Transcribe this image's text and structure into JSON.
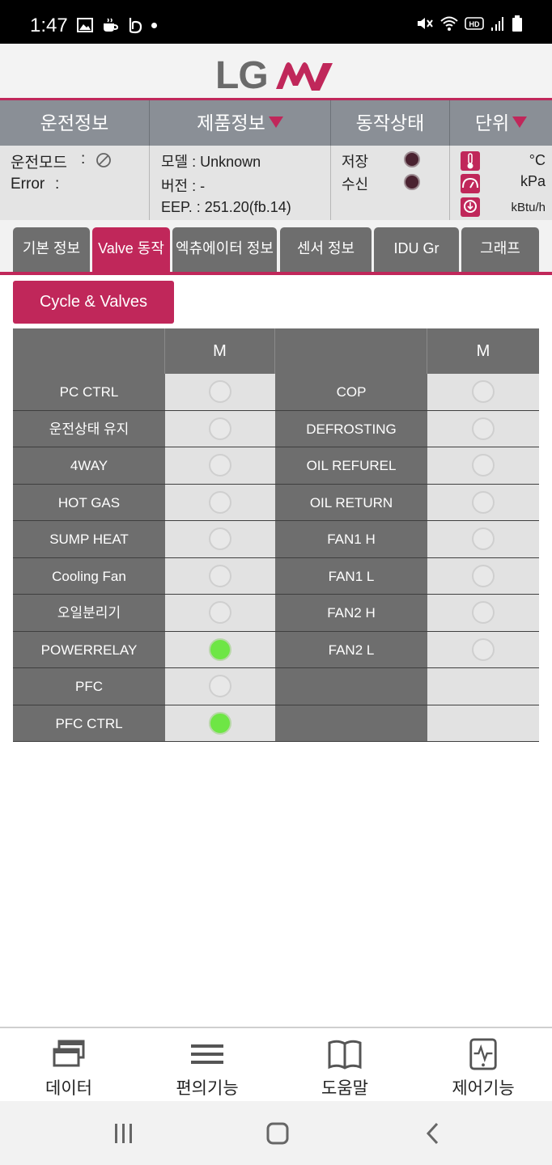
{
  "status_bar": {
    "time": "1:47"
  },
  "header": {
    "logo_lg": "LG",
    "logo_mv": "MV",
    "brand_color": "#c0275a"
  },
  "info_panel": {
    "headers": [
      "운전정보",
      "제품정보",
      "동작상태",
      "단위"
    ],
    "operation": {
      "mode_label": "운전모드",
      "mode_sep": ":",
      "error_label": "Error",
      "error_sep": ":"
    },
    "product": {
      "model": "모델 : Unknown",
      "version": "버전 : -",
      "eep": "EEP. : 251.20(fb.14)"
    },
    "status": {
      "save_label": "저장",
      "receive_label": "수신"
    },
    "units": {
      "temperature": "°C",
      "pressure": "kPa",
      "capacity": "kBtu/h"
    }
  },
  "tabs": [
    {
      "label": "기본 정보",
      "active": false
    },
    {
      "label": "Valve 동작",
      "active": true
    },
    {
      "label": "엑츄에이터 정보",
      "active": false
    },
    {
      "label": "센서 정보",
      "active": false
    },
    {
      "label": "IDU Gr",
      "active": false
    },
    {
      "label": "그래프",
      "active": false
    }
  ],
  "cycle_button": "Cycle & Valves",
  "valve_table": {
    "col_headers": [
      "",
      "M",
      "",
      "M"
    ],
    "left": [
      {
        "label": "PC CTRL",
        "on": false
      },
      {
        "label": "운전상태 유지",
        "on": false
      },
      {
        "label": "4WAY",
        "on": false
      },
      {
        "label": "HOT GAS",
        "on": false
      },
      {
        "label": "SUMP HEAT",
        "on": false
      },
      {
        "label": "Cooling Fan",
        "on": false
      },
      {
        "label": "오일분리기",
        "on": false
      },
      {
        "label": "POWERRELAY",
        "on": true
      },
      {
        "label": "PFC",
        "on": false
      },
      {
        "label": "PFC CTRL",
        "on": true
      }
    ],
    "right": [
      {
        "label": "COP",
        "on": false
      },
      {
        "label": "DEFROSTING",
        "on": false
      },
      {
        "label": "OIL REFUREL",
        "on": false
      },
      {
        "label": "OIL RETURN",
        "on": false
      },
      {
        "label": "FAN1 H",
        "on": false
      },
      {
        "label": "FAN1 L",
        "on": false
      },
      {
        "label": "FAN2 H",
        "on": false
      },
      {
        "label": "FAN2 L",
        "on": false
      },
      {
        "label": "",
        "on": null
      },
      {
        "label": "",
        "on": null
      }
    ],
    "on_color": "#6ee645"
  },
  "bottom_nav": [
    {
      "label": "데이터",
      "icon": "windows-icon"
    },
    {
      "label": "편의기능",
      "icon": "menu-icon"
    },
    {
      "label": "도움말",
      "icon": "book-icon"
    },
    {
      "label": "제어기능",
      "icon": "tablet-pulse-icon"
    }
  ]
}
